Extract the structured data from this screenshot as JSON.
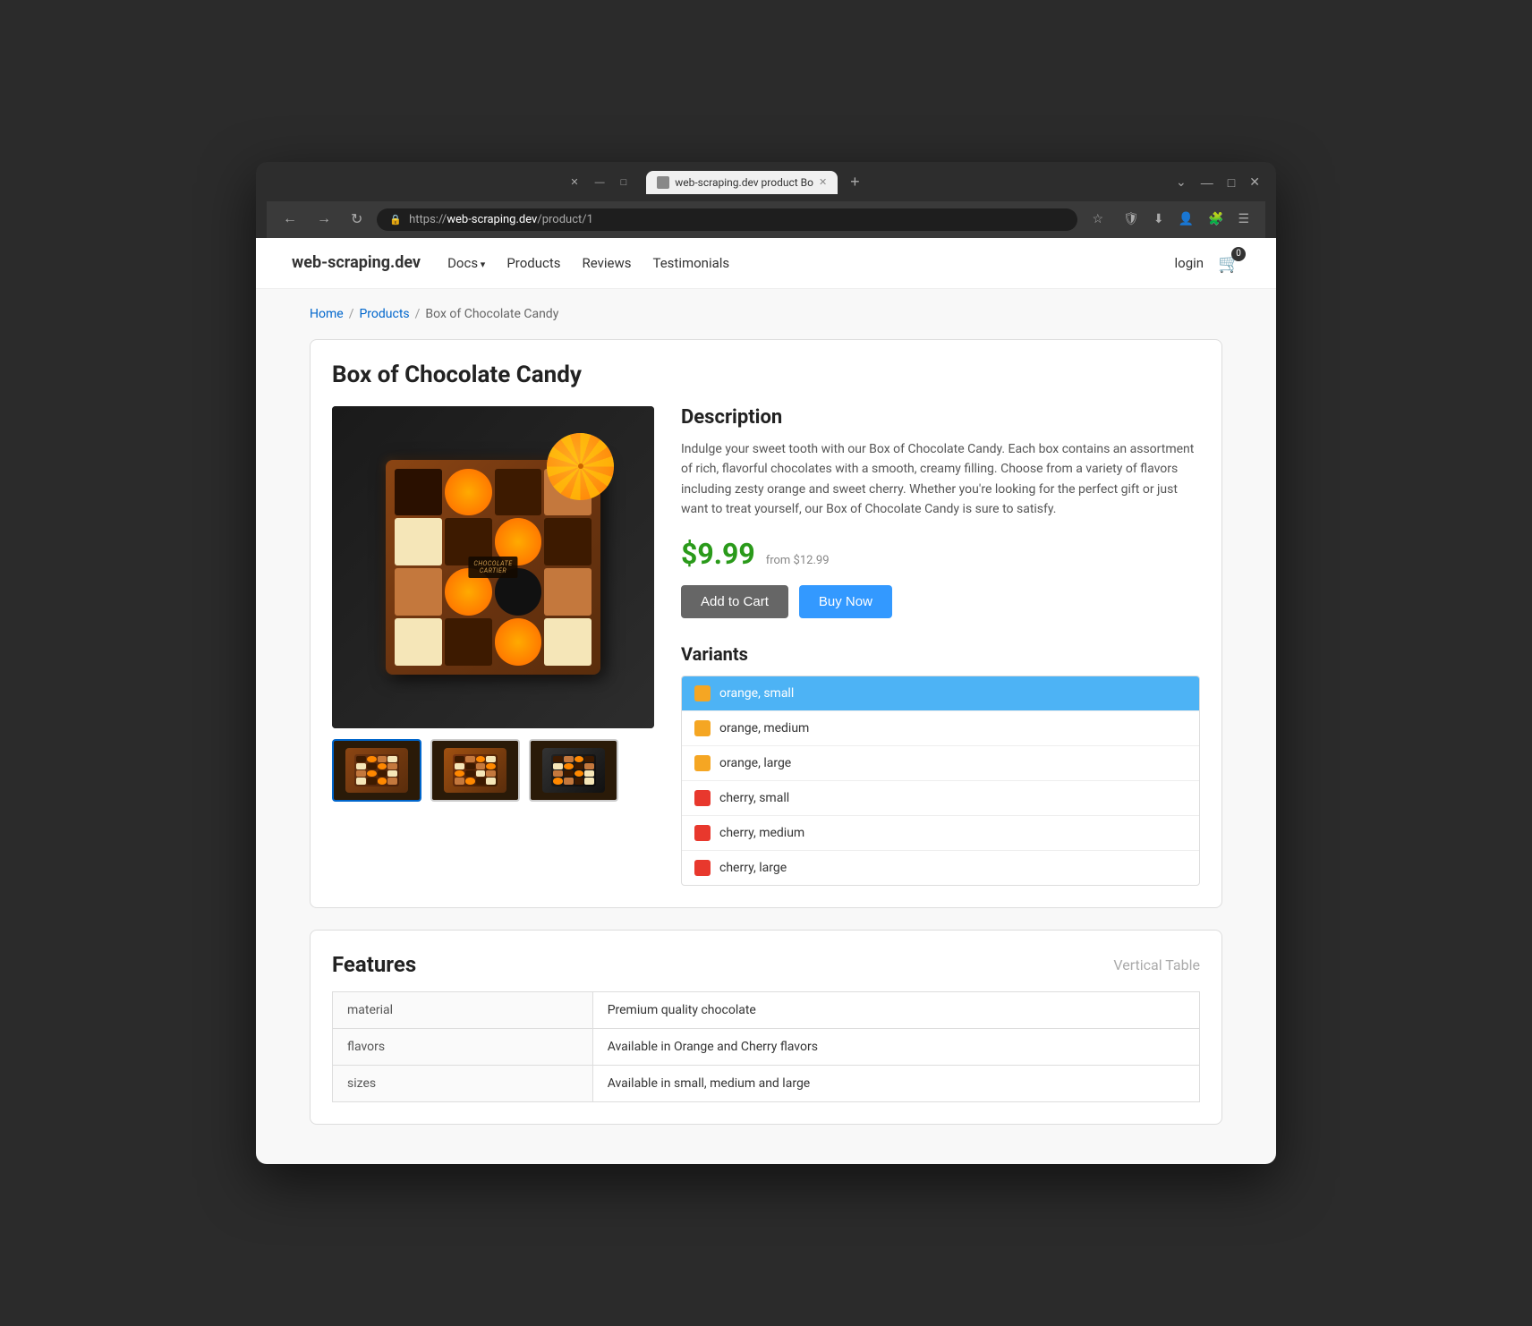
{
  "browser": {
    "tab_title": "web-scraping.dev product Bo",
    "url_scheme": "https://",
    "url_host": "web-scraping.dev",
    "url_path": "/product/1",
    "url_full": "https://web-scraping.dev/product/1",
    "new_tab_label": "+",
    "close_label": "✕",
    "minimize_label": "—",
    "maximize_label": "□",
    "close_window_label": "✕"
  },
  "nav": {
    "back_btn": "←",
    "forward_btn": "→",
    "refresh_btn": "↻",
    "star_btn": "☆",
    "icons": [
      "🔒"
    ]
  },
  "site": {
    "logo": "web-scraping.dev",
    "nav_items": [
      {
        "label": "Docs",
        "dropdown": true
      },
      {
        "label": "Products",
        "dropdown": false
      },
      {
        "label": "Reviews",
        "dropdown": false
      },
      {
        "label": "Testimonials",
        "dropdown": false
      }
    ],
    "login_label": "login",
    "cart_count": "0"
  },
  "breadcrumb": {
    "home": "Home",
    "products": "Products",
    "current": "Box of Chocolate Candy"
  },
  "product": {
    "title": "Box of Chocolate Candy",
    "description_title": "Description",
    "description": "Indulge your sweet tooth with our Box of Chocolate Candy. Each box contains an assortment of rich, flavorful chocolates with a smooth, creamy filling. Choose from a variety of flavors including zesty orange and sweet cherry. Whether you're looking for the perfect gift or just want to treat yourself, our Box of Chocolate Candy is sure to satisfy.",
    "price_current": "$9.99",
    "price_original": "from $12.99",
    "add_to_cart_label": "Add to Cart",
    "buy_now_label": "Buy Now",
    "variants_title": "Variants",
    "variants": [
      {
        "label": "orange, small",
        "color": "#f5a623",
        "active": true
      },
      {
        "label": "orange, medium",
        "color": "#f5a623",
        "active": false
      },
      {
        "label": "orange, large",
        "color": "#f5a623",
        "active": false
      },
      {
        "label": "cherry, small",
        "color": "#e8382d",
        "active": false
      },
      {
        "label": "cherry, medium",
        "color": "#e8382d",
        "active": false
      },
      {
        "label": "cherry, large",
        "color": "#e8382d",
        "active": false
      }
    ]
  },
  "features": {
    "title": "Features",
    "vertical_table_label": "Vertical Table",
    "rows": [
      {
        "key": "material",
        "value": "Premium quality chocolate"
      },
      {
        "key": "flavors",
        "value": "Available in Orange and Cherry flavors"
      },
      {
        "key": "sizes",
        "value": "Available in small, medium and large"
      }
    ]
  },
  "icons": {
    "cart": "🛒",
    "shield": "🛡",
    "download": "⬇",
    "extensions": "🧩",
    "menu": "☰",
    "profile": "👤",
    "page_icon": "📄",
    "lock": "🔒",
    "star": "☆"
  }
}
